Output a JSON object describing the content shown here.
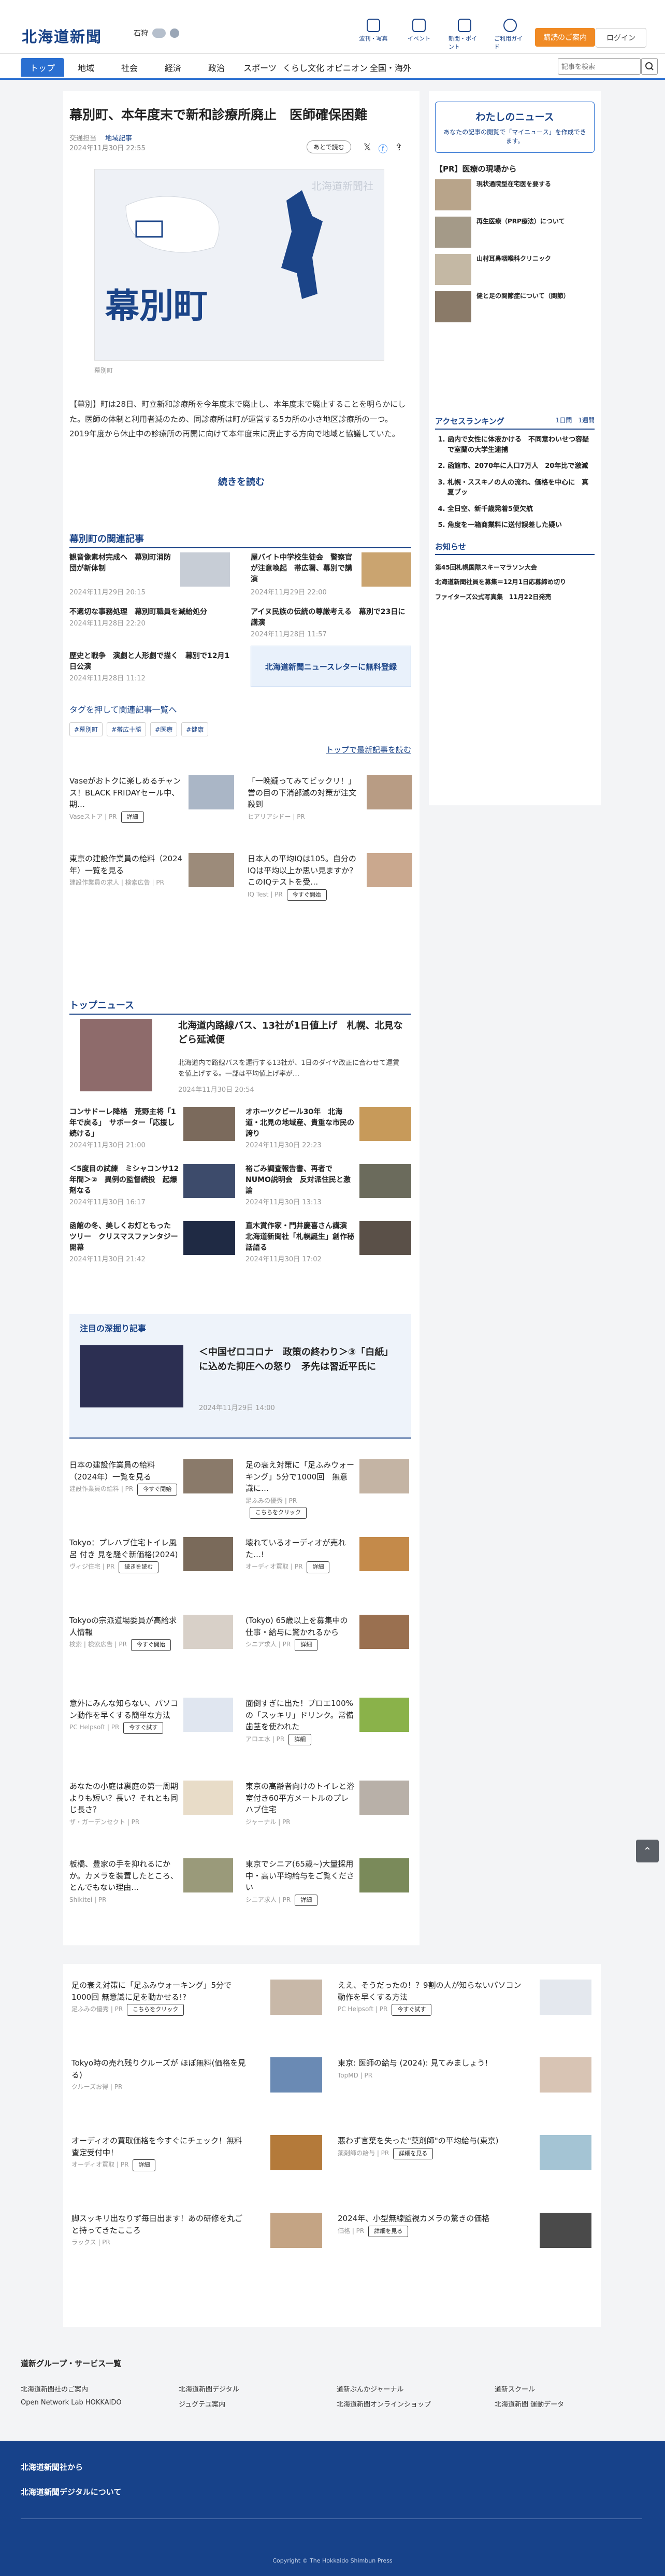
{
  "header": {
    "logo": "北海道新聞",
    "weather": {
      "city": "石狩",
      "temp": "☁"
    },
    "nav": [
      "波刊・写真",
      "イベント",
      "新聞・ポイント",
      "ご利用ガイド"
    ],
    "subscribe": "購読のご案内",
    "login": "ログイン",
    "search_placeholder": "記事を検索"
  },
  "gnav": [
    "トップ",
    "地域",
    "社会",
    "経済",
    "政治",
    "スポーツ",
    "くらし文化",
    "オピニオン",
    "全国・海外"
  ],
  "article": {
    "title": "幕別町、本年度末で新和診療所廃止　医師確保困難",
    "author": "交通担当",
    "category": "地域記事",
    "date": "2024年11月30日 22:55",
    "share": "あとで読む",
    "map_label": "幕別町",
    "map_credit": "北海道新聞社",
    "caption": "幕別町",
    "body": "【幕別】町は28日、町立新和診療所を今年度末で廃止し、本年度末で廃止することを明らかにした。医師の体制と利用者減のため、同診療所は町が運営する5カ所の小さ地区診療所の一つ。2019年度から休止中の診療所の再開に向けて本年度末に廃止する方向で地域と協議していた。",
    "more": "続きを読む"
  },
  "related": {
    "heading": "幕別町の関連記事",
    "items": [
      {
        "text": "観音像素材完成へ　幕別町消防団が新体制",
        "date": "2024年11月29日 20:15"
      },
      {
        "text": "屋バイト中学校生徒会　警察官が注意喚起　帯広署、幕別で講演",
        "date": "2024年11月29日 22:00"
      },
      {
        "text": "不適切な事務処理　幕別町職員を減給処分",
        "date": "2024年11月28日 22:20"
      },
      {
        "text": "アイヌ民族の伝統の尊厳考える　幕別で23日に講演",
        "date": "2024年11月28日 11:57"
      },
      {
        "text": "歴史と戦争　演劇と人形劇で描く　幕別で12月1日公演",
        "date": "2024年11月28日 11:12"
      }
    ],
    "banner": "北海道新聞ニュースレターに無料登録",
    "tags_heading": "タグを押して関連記事一覧へ",
    "tags": [
      "#幕別町",
      "#帯広十勝",
      "#医療",
      "#健康"
    ],
    "all": "トップで最新記事を読む"
  },
  "ads1": [
    {
      "text": "Vaseがおトクに楽しめるチャンス！BLACK FRIDAYセール中、期…",
      "src": "Vaseストア | PR",
      "btn": "詳細"
    },
    {
      "text": "「一晩疑ってみてビックリ！」営の目の下消部滅の対策が注文殺到",
      "src": "ヒアリアシドー | PR"
    },
    {
      "text": "東京の建設作業員の給料（2024年）一覧を見る",
      "src": "建設作業員の求人 | 検索広告 | PR"
    },
    {
      "text": "日本人の平均IQは105。自分のIQは平均以上か思い見ますか？このIQテストを受…",
      "src": "IQ Test | PR",
      "btn": "今すぐ開始"
    }
  ],
  "topnews": {
    "heading": "トップニュース",
    "lead": {
      "title": "北海道内路線バス、13社が1日値上げ　札幌、北見などら延減便",
      "summary": "北海道内で路線バスを運行する13社が、1日のダイヤ改正に合わせて運賃を値上げする。一部は平均値上げ率が…",
      "date": "2024年11月30日 20:54"
    },
    "items": [
      {
        "text": "コンサドーレ降格　荒野主将「1年で戻る」　サポーター「応援し続ける」",
        "date": "2024年11月30日 21:00"
      },
      {
        "text": "オホーツクビール30年　北海道・北見の地域産、貴重な市民の誇り",
        "date": "2024年11月30日 22:23"
      },
      {
        "text": "＜5度目の試練　ミシャコンサ12年間＞②　異例の監督続投　起爆剤なる",
        "date": "2024年11月30日 16:17"
      },
      {
        "text": "裕ごみ調査報告書、再者でNUMO説明会　反対派住民と激論",
        "date": "2024年11月30日 13:13"
      },
      {
        "text": "函館の冬、美しくお灯ともった ツリー　クリスマスファンタジー開幕",
        "date": "2024年11月30日 21:42"
      },
      {
        "text": "直木賞作家・門井慶喜さん講演　北海道新聞社「札幌誕生」創作秘話語る",
        "date": "2024年11月30日 17:02"
      }
    ]
  },
  "feature": {
    "heading": "注目の深掘り記事",
    "text": "＜中国ゼロコロナ　政策の終わり＞③「白紙」に込めた抑圧への怒り　矛先は習近平氏に",
    "date": "2024年11月29日 14:00"
  },
  "ads2": [
    {
      "text": "日本の建設作業員の給料（2024年）一覧を見る",
      "src": "建設作業員の給料 | PR",
      "btn": "今すぐ開始"
    },
    {
      "text": "足の衰え対策に「足ふみウォーキング」5分で1000回　無意識に…",
      "src": "足ふみの優秀 | PR",
      "btn": "こちらをクリック"
    },
    {
      "text": "Tokyo：プレハブ住宅トイレ風呂 付き 見を騒ぐ新価格(2024)",
      "src": "ヴィジ住宅 | PR",
      "btn": "続きを読む"
    },
    {
      "text": "壊れているオーディオが売れた…!",
      "src": "オーディオ買取 | PR",
      "btn": "詳細"
    },
    {
      "text": "Tokyoの宗派道場委員が高給求人情報",
      "src": "検索 | 検索広告 | PR",
      "btn": "今すぐ開始"
    },
    {
      "text": "(Tokyo) 65歳以上を募集中の仕事・給与に驚かれるから",
      "src": "シニア求人 | PR",
      "btn": "詳細"
    },
    {
      "text": "意外にみんな知らない、パソコン動作を早くする簡単な方法",
      "src": "PC Helpsoft | PR",
      "btn": "今すぐ試す"
    },
    {
      "text": "面倒すぎに出た！プロエ100%の「スッキリ」ドリンク。常備歯茎を使われた",
      "src": "アロエ水 | PR",
      "btn": "詳細"
    },
    {
      "text": "あなたの小庭は裏庭の第一周期よりも短い？長い？それとも同じ長さ？",
      "src": "ザ・ガーデンセクト | PR"
    },
    {
      "text": "東京の高齢者向けのトイレと浴室付き60平方メートルのプレハブ住宅",
      "src": "ジャーナル | PR"
    },
    {
      "text": "板橋、豊家の手を抑れるにかか。カメラを装置したところ、とんでもない理由…",
      "src": "Shikitei | PR"
    },
    {
      "text": "東京でシニア(65歳~)大量採用中・高い平均給与をご覧ください",
      "src": "シニア求人 | PR",
      "btn": "詳細"
    }
  ],
  "ads3": [
    {
      "text": "足の衰え対策に「足ふみウォーキング」5分で1000回 無意識に足を動かせる!?",
      "src": "足ふみの優秀 | PR",
      "btn": "こちらをクリック"
    },
    {
      "text": "ええ、そうだったの！？9割の人が知らないパソコン動作を早くする方法",
      "src": "PC Helpsoft | PR",
      "btn": "今すぐ試す"
    },
    {
      "text": "Tokyo時の売れ残りクルーズが ほぼ無料(価格を見る)",
      "src": "クルーズお得 | PR"
    },
    {
      "text": "東京: 医師の給与 (2024): 見てみましょう!",
      "src": "TopMD | PR"
    },
    {
      "text": "オーディオの買取価格を今すぐにチェック！無料査定受付中！",
      "src": "オーディオ買取 | PR",
      "btn": "詳細"
    },
    {
      "text": "悪わず言葉を失った\"薬剤師\"の平均給与(東京)",
      "src": "薬剤師の給与 | PR",
      "btn": "詳細を見る"
    },
    {
      "text": "脚スッキリ出なりず毎日出ます！あの研修を丸ごと持ってきたこころ",
      "src": "ラックス | PR"
    },
    {
      "text": "2024年、小型無線監視カメラの驚きの価格",
      "src": "価格 | PR",
      "btn": "詳細を見る"
    }
  ],
  "side": {
    "mynews": {
      "title": "わたしのニュース",
      "desc": "あなたの記事の閲覧で「マイニュース」を作成できます。"
    },
    "pr_heading": "【PR】医療の現場から",
    "pr": [
      "現状通院型在宅医を要する",
      "再生医療（PRP療法）について",
      "山村耳鼻咽喉科クリニック",
      "健と足の関節症について（関節）"
    ],
    "access": {
      "heading": "アクセスランキング",
      "tabs": [
        "1日間",
        "1週間"
      ],
      "items": [
        "函内で女性に体液かける　不同意わいせつ容疑で室蘭の大学生逮捕",
        "函館市、2070年に人口7万人　20年比で激減",
        "札幌・ススキノの人の流れ、価格を中心に　真夏ブッ",
        "全日空、新千歳発着5便欠航",
        "角度を一箱商業料に送付誤差した疑い"
      ]
    },
    "notice": {
      "heading": "お知らせ",
      "items": [
        "第45回札幌国際スキーマラソン大会",
        "北海道新聞社員を募集＝12月1日応募締め切り",
        "ファイターズ公式写真集　11月22日発売"
      ]
    }
  },
  "footer": {
    "group": "道新グループ・サービス一覧",
    "links": [
      "北海道新聞社のご案内",
      "北海道新聞デジタル",
      "道新ぶんかジャーナル",
      "道新スクール",
      "Open Network Lab HOKKAIDO",
      "ジュグテユ案内",
      "北海道新聞オンラインショップ",
      "北海道新聞 運動データ"
    ],
    "bottom": [
      "北海道新聞社から",
      "北海道新聞デジタルについて"
    ],
    "copyright": "Copyright © The Hokkaido Shimbun Press"
  }
}
